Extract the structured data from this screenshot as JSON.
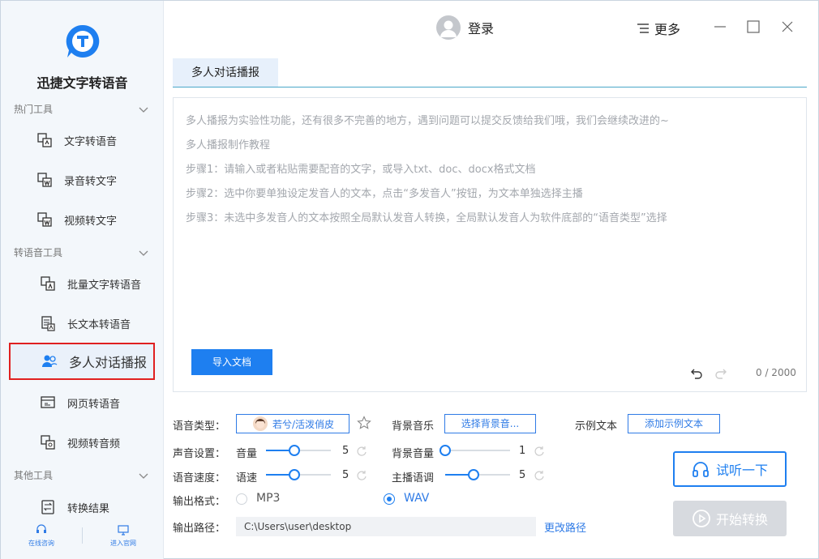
{
  "app": {
    "name": "迅捷文字转语音"
  },
  "sidebar": {
    "sections": [
      {
        "label": "热门工具"
      },
      {
        "label": "转语音工具"
      },
      {
        "label": "其他工具"
      }
    ],
    "items": [
      {
        "label": "文字转语音",
        "icon": "text-to-speech-icon"
      },
      {
        "label": "录音转文字",
        "icon": "recording-to-text-icon"
      },
      {
        "label": "视频转文字",
        "icon": "video-to-text-icon"
      },
      {
        "label": "批量文字转语音",
        "icon": "batch-text-icon"
      },
      {
        "label": "长文本转语音",
        "icon": "long-text-icon"
      },
      {
        "label": "多人对话播报",
        "icon": "multi-person-icon",
        "active": true
      },
      {
        "label": "网页转语音",
        "icon": "webpage-icon"
      },
      {
        "label": "视频转音频",
        "icon": "video-to-audio-icon"
      },
      {
        "label": "转换结果",
        "icon": "results-icon"
      }
    ],
    "bottom": {
      "online_consult": "在线咨询",
      "visit_site": "进入官网"
    }
  },
  "topbar": {
    "login": "登录",
    "more": "更多"
  },
  "tab": {
    "label": "多人对话播报"
  },
  "editor": {
    "hints": [
      "多人播报为实验性功能，还有很多不完善的地方，遇到问题可以提交反馈给我们哦，我们会继续改进的~",
      "多人播报制作教程",
      "步骤1：请输入或者粘贴需要配音的文字，或导入txt、doc、docx格式文档",
      "步骤2：选中你要单独设定发音人的文本，点击“多发音人”按钮，为文本单独选择主播",
      "步骤3：未选中多发音人的文本按照全局默认发音人转换，全局默认发音人为软件底部的“语音类型”选择"
    ],
    "import_button": "导入文档",
    "counter": "0 / 2000"
  },
  "settings": {
    "voice_type_label": "语音类型：",
    "voice_name": "若兮/活泼俏皮",
    "bg_music_label": "背景音乐",
    "bg_music_button": "选择背景音...",
    "sample_text_label": "示例文本",
    "sample_text_button": "添加示例文本",
    "sound_settings_label": "声音设置：",
    "volume_label": "音量",
    "volume_value": "5",
    "bg_volume_label": "背景音量",
    "bg_volume_value": "1",
    "speed_label_outer": "语音速度：",
    "speed_label": "语速",
    "speed_value": "5",
    "pitch_label": "主播语调",
    "pitch_value": "5",
    "format_label": "输出格式：",
    "format_options": [
      "MP3",
      "WAV"
    ],
    "format_selected": "WAV",
    "path_label": "输出路径：",
    "path_value": "C:\\Users\\user\\desktop",
    "change_path": "更改路径",
    "listen_button": "试听一下",
    "start_button": "开始转换"
  },
  "colors": {
    "accent": "#1e7ff0",
    "highlight_border": "#e02020"
  }
}
